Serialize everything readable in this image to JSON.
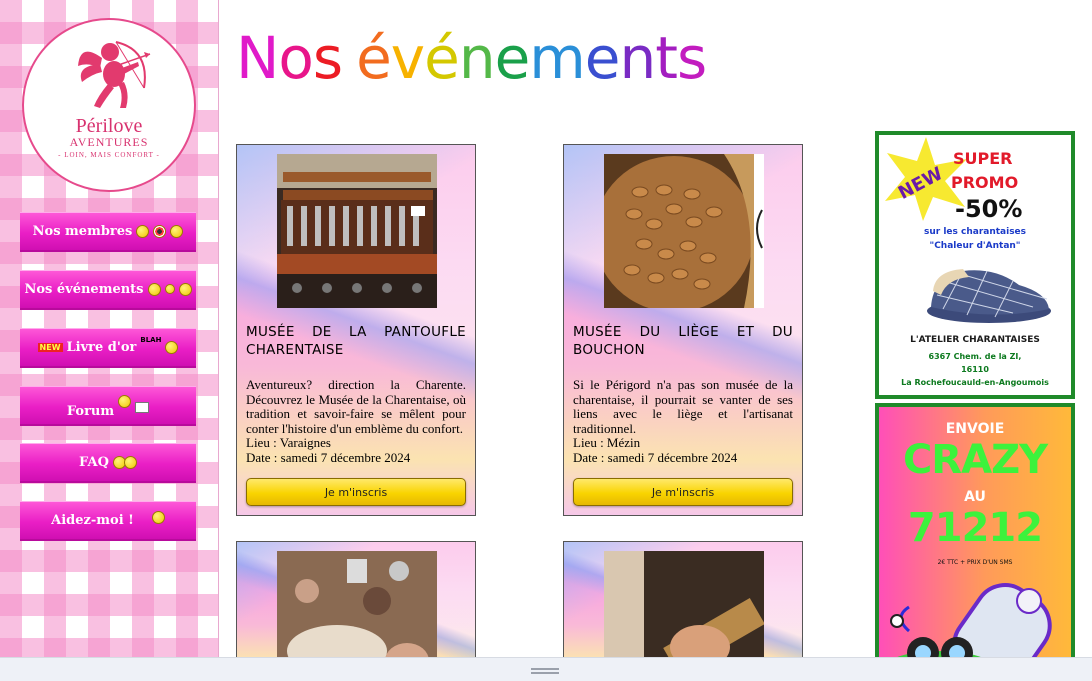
{
  "logo": {
    "name": "Périlove",
    "sub": "AVENTURES",
    "tagline": "- LOIN, MAIS CONFORT -"
  },
  "nav": {
    "items": [
      {
        "label": "Nos membres"
      },
      {
        "label": "Nos événements"
      },
      {
        "label": "Livre d'or",
        "badge": "NEW",
        "extra": "BLAH"
      },
      {
        "label": "Forum"
      },
      {
        "label": "FAQ"
      },
      {
        "label": "Aidez-moi !"
      }
    ]
  },
  "page": {
    "title": "Nos événements",
    "title_colors": [
      "#e01ac9",
      "#e8158a",
      "#ec1c24",
      "#f26c1f",
      "#f7b200",
      "#d4c800",
      "#54b848",
      "#1aa04a",
      "#2a8fd8",
      "#3a4fd0",
      "#7a2bc4",
      "#a31ec0",
      "#c21cbf",
      "#d01ac5"
    ]
  },
  "events": [
    {
      "title": "MUSÉE DE LA PANTOUFLE CHARENTAISE",
      "description": "Aventureux? direction la Charente. Découvrez le Musée de la Charentaise, où tradition et savoir-faire se mêlent pour conter l'histoire d'un emblème du confort.",
      "lieu": "Lieu : Varaignes",
      "date": "Date : samedi 7 décembre 2024",
      "button": "Je m'inscris"
    },
    {
      "title": "MUSÉE DU LIÈGE ET DU BOUCHON",
      "description": "Si le Périgord n'a pas son musée de la charentaise, il pourrait se vanter de ses liens avec le liège et l'artisanat traditionnel.",
      "lieu": "Lieu : Mézin",
      "date": "Date : samedi 7 décembre 2024",
      "button": "Je m'inscris"
    }
  ],
  "ad_promo": {
    "new": "NEW",
    "line1": "SUPER",
    "line2": "PROMO",
    "discount": "-50%",
    "desc1": "sur les charantaises",
    "desc2": "\"Chaleur d'Antan\"",
    "shop": "L'ATELIER CHARANTAISES",
    "addr1": "6367 Chem. de la ZI,",
    "addr2": "16110",
    "addr3": "La Rochefoucauld-en-Angoumois"
  },
  "ad_crazy": {
    "line1": "ENVOIE",
    "line2": "CRAZY",
    "line3": "AU",
    "number": "71212",
    "fine": "2€ TTC + PRIX D'UN SMS"
  }
}
